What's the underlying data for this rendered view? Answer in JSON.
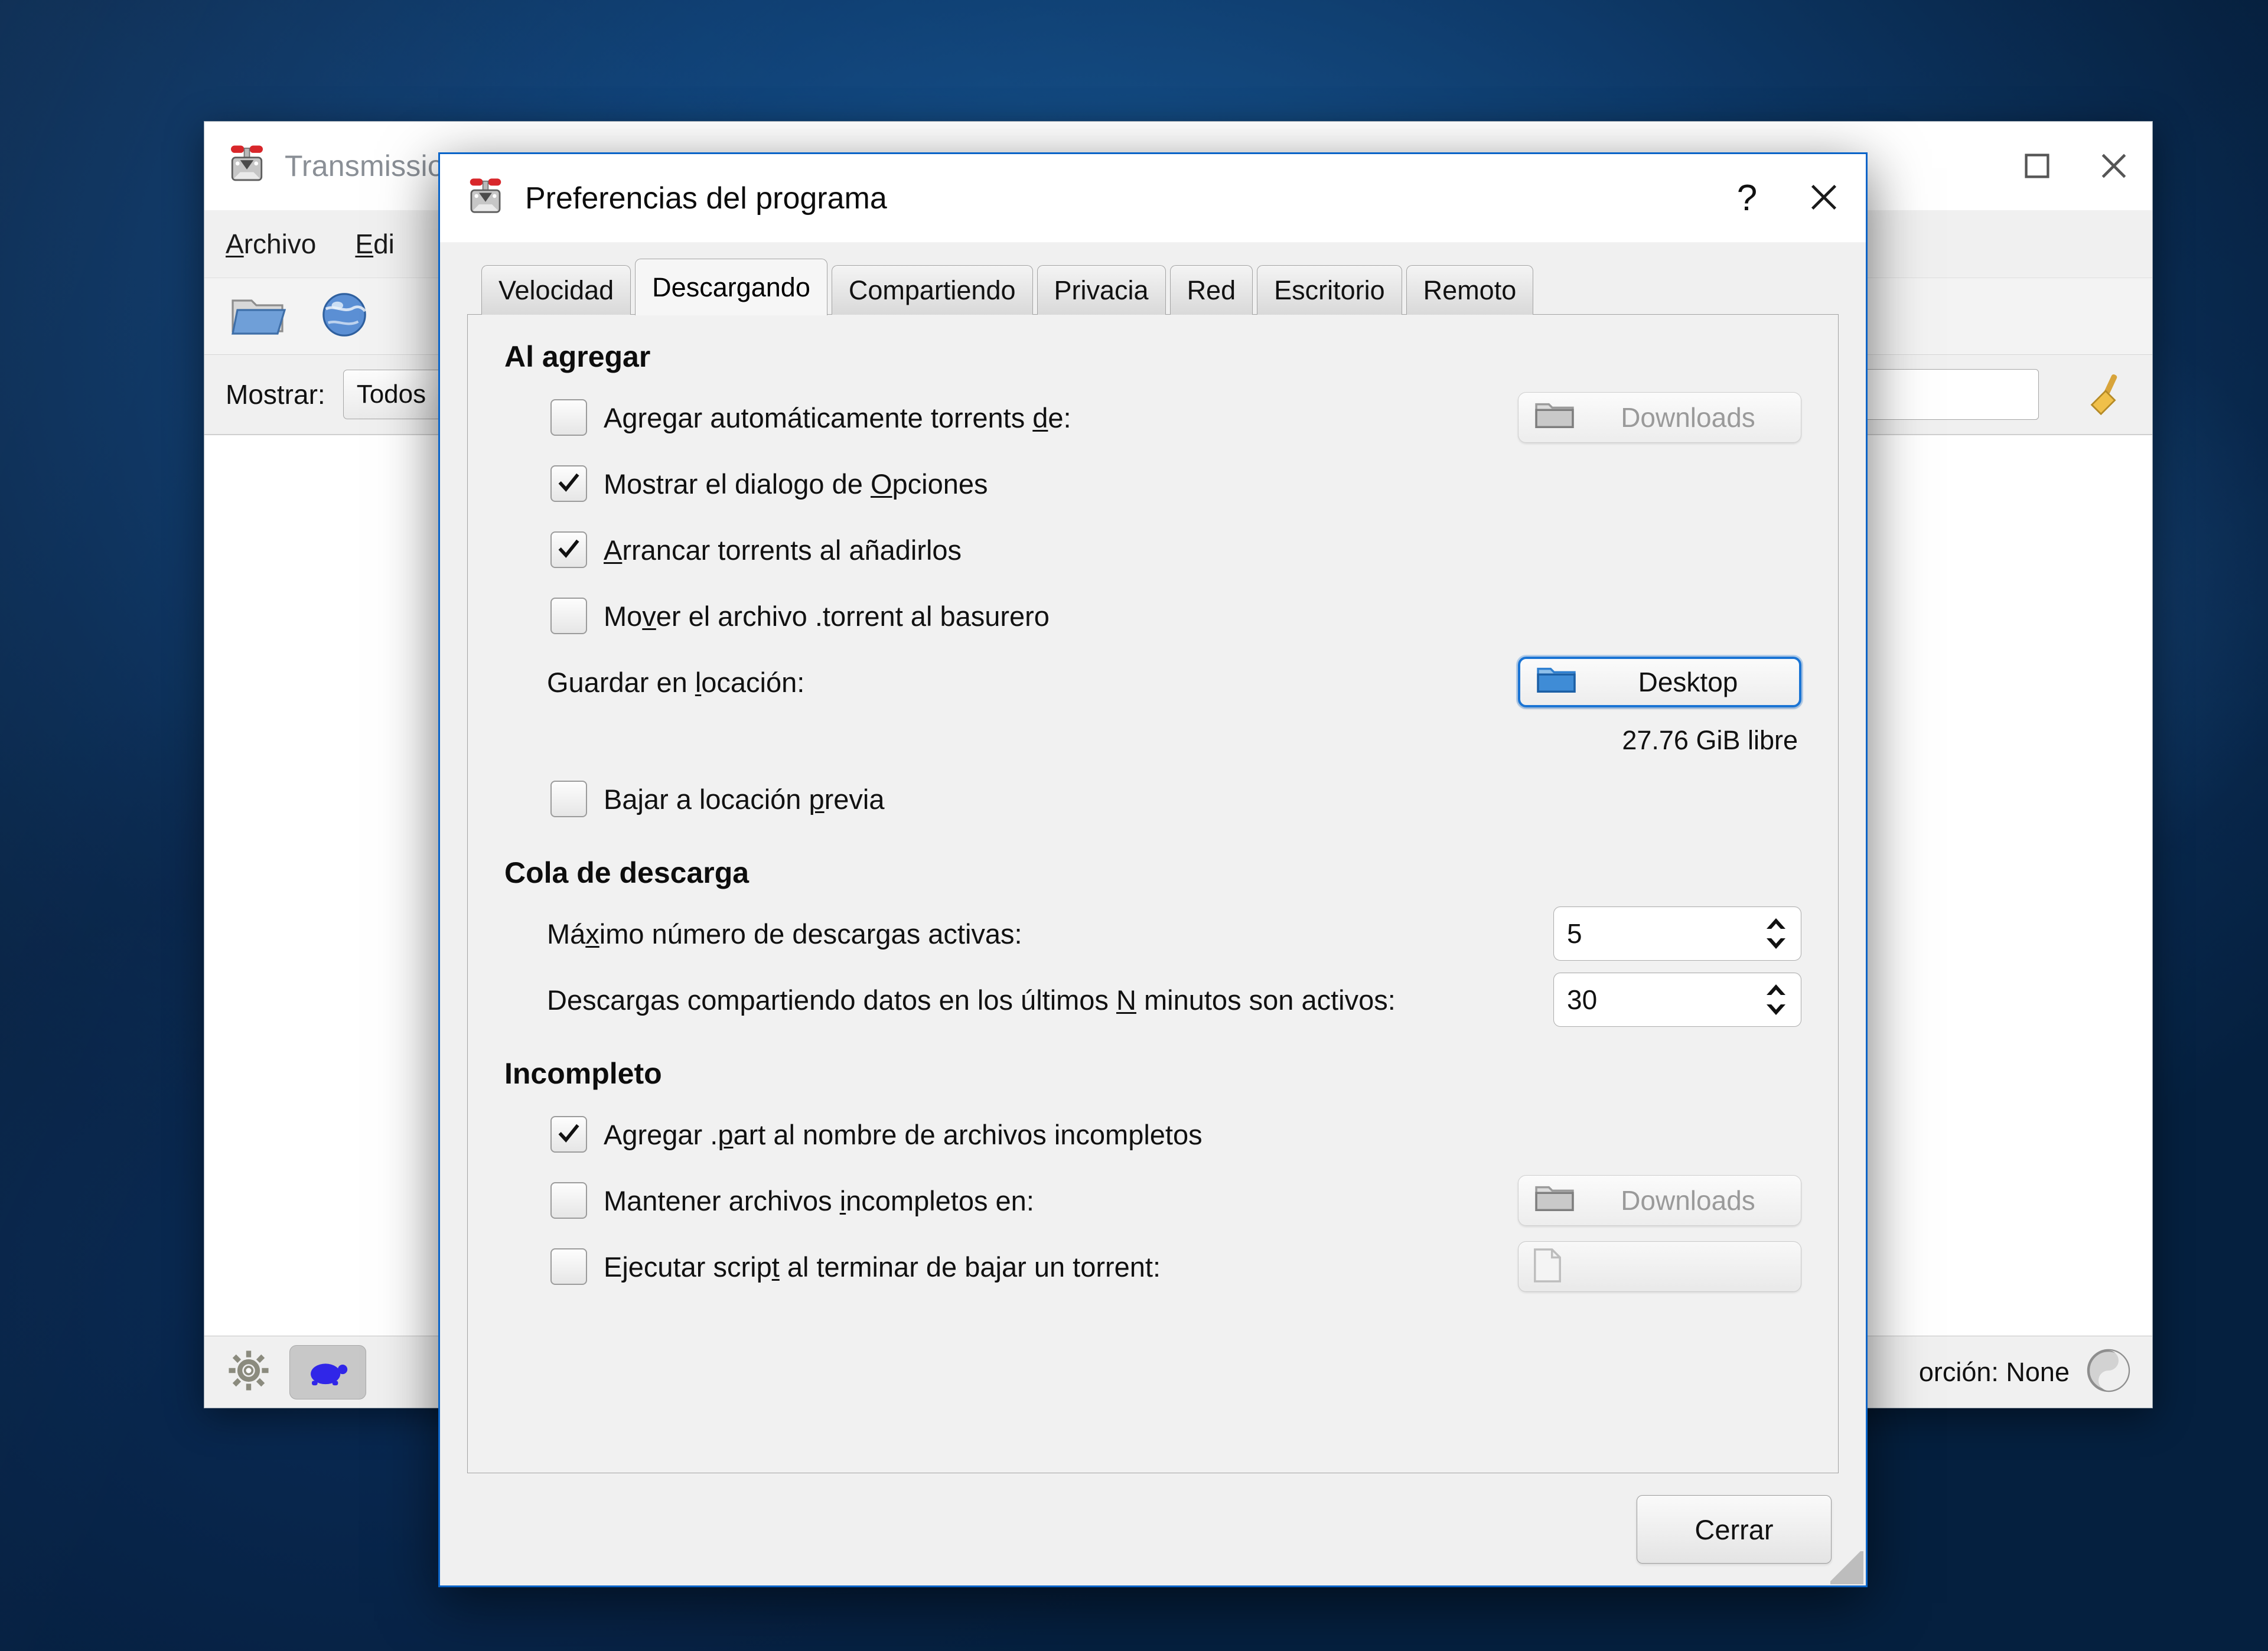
{
  "main_window": {
    "title": "Transmission",
    "app_icon": "transmission-icon",
    "menu": [
      {
        "label": "Archivo",
        "accel": "A"
      },
      {
        "label": "Edi",
        "accel": "E"
      }
    ],
    "toolbar": [
      {
        "name": "open-torrent-button",
        "icon": "open-folder-icon"
      },
      {
        "name": "open-url-button",
        "icon": "globe-icon"
      }
    ],
    "filter": {
      "label": "Mostrar:",
      "combo_value": "Todos",
      "search_placeholder": ""
    },
    "window_buttons": [
      {
        "name": "maximize-button",
        "icon": "square-icon"
      },
      {
        "name": "close-button",
        "icon": "close-x-icon"
      }
    ],
    "statusbar": {
      "settings_icon": "gear-icon",
      "turtle_icon": "turtle-icon",
      "ratio_text": "orción: None",
      "ratio_icon": "yin-yang-icon"
    }
  },
  "prefs": {
    "title": "Preferencias del programa",
    "icon": "transmission-icon",
    "help_label": "?",
    "close_label": "✕",
    "tabs": [
      {
        "label": "Velocidad",
        "active": false
      },
      {
        "label": "Descargando",
        "active": true
      },
      {
        "label": "Compartiendo",
        "active": false
      },
      {
        "label": "Privacia",
        "active": false
      },
      {
        "label": "Red",
        "active": false
      },
      {
        "label": "Escritorio",
        "active": false
      },
      {
        "label": "Remoto",
        "active": false
      }
    ],
    "groups": {
      "adding": {
        "header": "Al agregar",
        "auto_add": {
          "label_pre": "Agregar automáticamente torrents ",
          "label_accel": "d",
          "label_post": "e:",
          "checked": false,
          "button_label": "Downloads",
          "button_enabled": false
        },
        "show_options_dialog": {
          "label_pre": "Mostrar el dialogo de ",
          "label_accel": "O",
          "label_post": "pciones",
          "checked": true
        },
        "start_on_add": {
          "label_pre": "",
          "label_accel": "A",
          "label_post": "rrancar torrents al añadirlos",
          "checked": true
        },
        "trash_torrent": {
          "label_pre": "Mo",
          "label_accel": "v",
          "label_post": "er el archivo .torrent al basurero",
          "checked": false
        },
        "save_location": {
          "label_pre": "Guardar en ",
          "label_accel": "l",
          "label_post": "ocación:",
          "button_label": "Desktop",
          "free_space": "27.76 GiB libre"
        },
        "previous_location": {
          "label_pre": "Bajar a locación ",
          "label_accel": "p",
          "label_post": "revia",
          "checked": false
        }
      },
      "queue": {
        "header": "Cola de descarga",
        "max_active": {
          "label_pre": "Má",
          "label_accel": "x",
          "label_post": "imo número de descargas activas:",
          "value": "5"
        },
        "stalled_minutes": {
          "label_pre": "Descargas compartiendo datos en los últimos ",
          "label_accel": "N",
          "label_post": " minutos son activos:",
          "value": "30"
        }
      },
      "incomplete": {
        "header": "Incompleto",
        "part_suffix": {
          "label_pre": "Agregar .",
          "label_accel": "p",
          "label_post": "art al nombre de archivos incompletos",
          "checked": true
        },
        "incomplete_dir": {
          "label_pre": "Mantener archivos ",
          "label_accel": "i",
          "label_post": "ncompletos en:",
          "checked": false,
          "button_label": "Downloads",
          "button_enabled": false
        },
        "run_script": {
          "label_pre": "Ejecutar scrip",
          "label_accel": "t",
          "label_post": " al terminar de bajar un torrent:",
          "checked": false,
          "field_value": ""
        }
      }
    },
    "footer": {
      "close_button": "Cerrar"
    }
  },
  "colors": {
    "accent_blue": "#0a64c8",
    "dialog_bg": "#f0f0f0",
    "panel_bg": "#f1f1f1",
    "focus_blue": "#1a74d4",
    "disabled_text": "#9a9a9a",
    "folder_blue": "#2f7fd0",
    "turtle_blue": "#3026e8"
  }
}
